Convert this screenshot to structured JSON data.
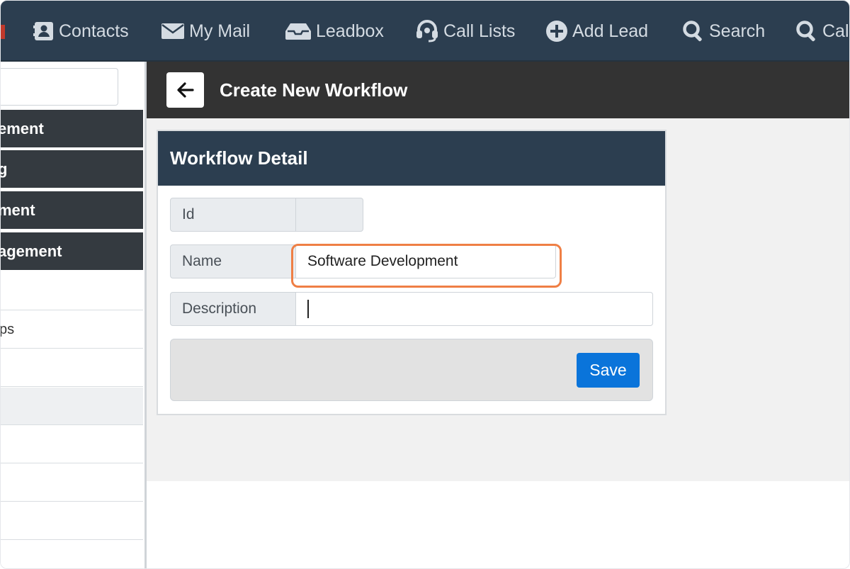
{
  "topnav": {
    "items": [
      {
        "label": "Contacts",
        "icon": "contacts-icon"
      },
      {
        "label": "My Mail",
        "icon": "mail-icon"
      },
      {
        "label": "Leadbox",
        "icon": "inbox-icon"
      },
      {
        "label": "Call Lists",
        "icon": "headset-icon"
      },
      {
        "label": "Add Lead",
        "icon": "plus-circle-icon"
      },
      {
        "label": "Search",
        "icon": "search-icon"
      },
      {
        "label": "Cal",
        "icon": "search-icon"
      }
    ]
  },
  "sidebar": {
    "search_placeholder": "",
    "dark_items": [
      {
        "label": "ement"
      },
      {
        "label": "g"
      },
      {
        "label": "ment"
      },
      {
        "label": "agement"
      }
    ],
    "light_items": [
      {
        "label": ""
      },
      {
        "label": "ps"
      },
      {
        "label": ""
      },
      {
        "label": ""
      },
      {
        "label": ""
      },
      {
        "label": ""
      },
      {
        "label": ""
      },
      {
        "label": ""
      }
    ]
  },
  "header": {
    "title": "Create New Workflow",
    "back_icon": "arrow-left-icon"
  },
  "card": {
    "title": "Workflow Detail",
    "fields": {
      "id": {
        "label": "Id",
        "value": ""
      },
      "name": {
        "label": "Name",
        "value": "Software Development"
      },
      "description": {
        "label": "Description",
        "value": ""
      }
    },
    "save_label": "Save"
  },
  "colors": {
    "nav_bg": "#2c3e50",
    "header_bg": "#333333",
    "highlight": "#ef7f45",
    "save_button": "#0a74da"
  }
}
